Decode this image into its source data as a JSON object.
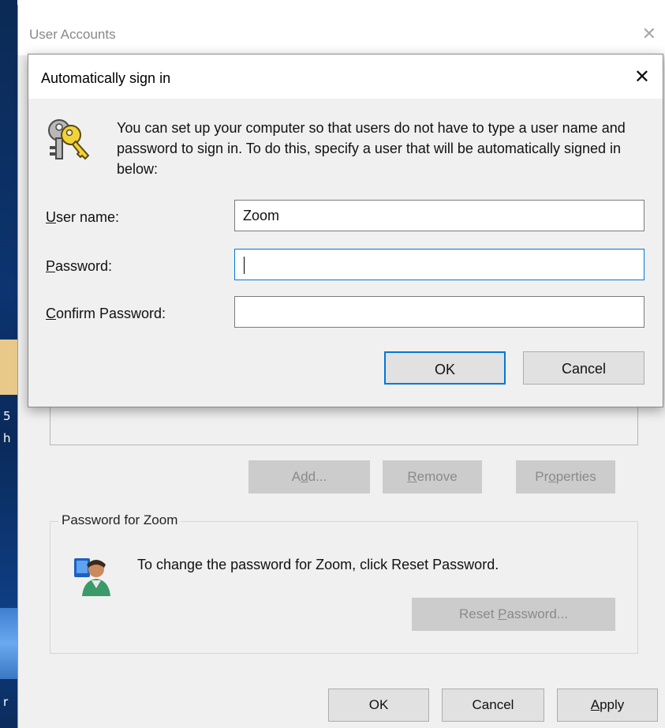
{
  "back_window": {
    "title": "User Accounts",
    "close_glyph": "✕",
    "list_buttons": {
      "add": {
        "pre": "A",
        "accel": "d",
        "post": "d..."
      },
      "remove": {
        "pre": "",
        "accel": "R",
        "post": "emove"
      },
      "properties": {
        "pre": "Pr",
        "accel": "o",
        "post": "perties"
      }
    },
    "password_group": {
      "label": "Password for Zoom",
      "text": "To change the password for Zoom, click Reset Password.",
      "reset_button": {
        "pre": "Reset ",
        "accel": "P",
        "post": "assword..."
      }
    },
    "bottom_buttons": {
      "ok": "OK",
      "cancel": "Cancel",
      "apply": {
        "pre": "",
        "accel": "A",
        "post": "pply"
      }
    }
  },
  "dialog": {
    "title": "Automatically sign in",
    "close_glyph": "✕",
    "info": "You can set up your computer so that users do not have to type a user name and password to sign in. To do this, specify a user that will be automatically signed in below:",
    "fields": {
      "username": {
        "accel": "U",
        "rest": "ser name:",
        "value": "Zoom"
      },
      "password": {
        "accel": "P",
        "rest": "assword:",
        "value": ""
      },
      "confirm": {
        "accel": "C",
        "rest": "onfirm Password:",
        "value": ""
      }
    },
    "buttons": {
      "ok": "OK",
      "cancel": "Cancel"
    }
  },
  "icons": {
    "dialog_icon": "keys-icon",
    "user_icon": "user-account-icon"
  },
  "colors": {
    "accent": "#0078d7",
    "disabled_button": "#cccccc",
    "window_bg": "#f0f0f0"
  },
  "desktop_edge_text": [
    "5",
    "h",
    "r"
  ]
}
